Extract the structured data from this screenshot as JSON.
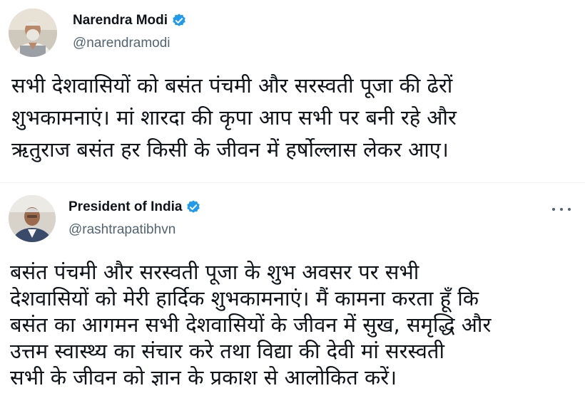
{
  "tweets": [
    {
      "author": {
        "name": "Narendra Modi",
        "handle": "@narendramodi",
        "verified": true,
        "avatar_icon": "avatar-photo"
      },
      "body_lines": [
        "सभी देशवासियों को बसंत पंचमी और सरस्वती पूजा की ढेरों",
        "शुभकामनाएं। मां शारदा की कृपा आप सभी पर बनी रहे और",
        "ऋतुराज बसंत हर किसी के जीवन में हर्षोल्लास लेकर आए।"
      ]
    },
    {
      "author": {
        "name": "President of India",
        "handle": "@rashtrapatibhvn",
        "verified": true,
        "avatar_icon": "avatar-photo"
      },
      "more_icon": "more-options-icon",
      "body_lines": [
        "बसंत पंचमी और सरस्वती पूजा के शुभ अवसर पर सभी",
        "देशवासियों को मेरी हार्दिक शुभकामनाएं। मैं कामना करता हूँ कि",
        "बसंत का आगमन सभी देशवासियों के जीवन में सुख, समृद्धि और",
        "उत्तम स्वास्थ्य का संचार करे तथा विद्या की देवी मां सरस्वती",
        "सभी के जीवन को ज्ञान के प्रकाश से आलोकित करें।"
      ]
    }
  ],
  "colors": {
    "verified_badge": "#1d9bf0",
    "name_text": "#0f1419",
    "handle_text": "#536471",
    "divider": "#eff3f4"
  }
}
